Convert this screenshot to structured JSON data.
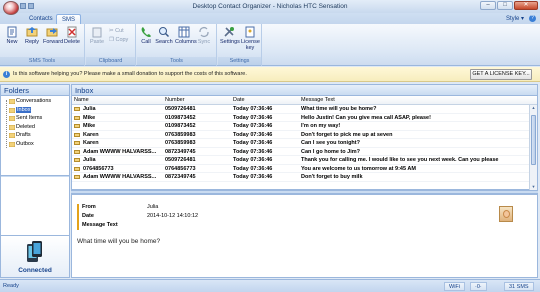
{
  "window": {
    "title": "Desktop Contact Organizer - Nicholas HTC Sensation",
    "minimize": "–",
    "maximize": "□",
    "close": "✕"
  },
  "tabs": [
    {
      "label": "Contacts",
      "active": false
    },
    {
      "label": "SMS",
      "active": true
    }
  ],
  "style_menu": "Style ▾",
  "help": "?",
  "ribbon": {
    "sms_tools": {
      "label": "SMS Tools",
      "buttons": [
        "New",
        "Reply",
        "Forward",
        "Delete"
      ]
    },
    "clipboard": {
      "label": "Clipboard",
      "paste": "Paste",
      "cut": "Cut",
      "copy": "Copy"
    },
    "tools": {
      "label": "Tools",
      "buttons": [
        "Call",
        "Search",
        "Columns",
        "Sync"
      ]
    },
    "settings": {
      "label": "Settings",
      "settings": "Settings",
      "license_key_1": "License",
      "license_key_2": "key"
    }
  },
  "infobar": {
    "icon": "i",
    "text": "Is this software helping you? Please make a small donation to support the costs of this software.",
    "button": "GET A LICENSE KEY..."
  },
  "folders": {
    "title": "Folders",
    "items": [
      "Conversations",
      "Inbox",
      "Sent Items",
      "Deleted",
      "Drafts",
      "Outbox"
    ],
    "selected": "Inbox",
    "connection_status": "Connected"
  },
  "inbox": {
    "title": "Inbox",
    "columns": [
      "Name",
      "Number",
      "Date",
      "Message Text"
    ],
    "rows": [
      {
        "name": "Julia",
        "number": "0509726481",
        "date": "Today  07:36:46",
        "text": "What time will you be home?"
      },
      {
        "name": "Mike",
        "number": "0109873452",
        "date": "Today  07:36:46",
        "text": "Hello Justin! Can you give mea call ASAP, please!"
      },
      {
        "name": "Mike",
        "number": "0109873452",
        "date": "Today  07:36:46",
        "text": "I'm on my way!"
      },
      {
        "name": "Karen",
        "number": "0763859983",
        "date": "Today  07:36:46",
        "text": "Don't forget to pick me up at seven"
      },
      {
        "name": "Karen",
        "number": "0763859983",
        "date": "Today  07:36:46",
        "text": "Can I see you tonight?"
      },
      {
        "name": "Adam WWWW  HALVARSS...",
        "number": "0872349745",
        "date": "Today  07:36:46",
        "text": "Can I go home to Jim?"
      },
      {
        "name": "Julia",
        "number": "0509726481",
        "date": "Today  07:36:46",
        "text": "Thank you for calling me. I would like to see you next week. Can you please"
      },
      {
        "name": "0764856773",
        "number": "0764856773",
        "date": "Today  07:36:46",
        "text": "You are welcome to us tomorrow at 9:45 AM"
      },
      {
        "name": "Adam WWWW  HALVARSS...",
        "number": "0872349745",
        "date": "Today  07:36:46",
        "text": "Don't forget to buy milk"
      }
    ]
  },
  "preview": {
    "from_label": "From",
    "from_value": "Julia",
    "date_label": "Date",
    "date_value": "2014-10-12 14:10:12",
    "text_label": "Message Text",
    "body": "What time will you be home?"
  },
  "statusbar": {
    "left": "Ready",
    "wifi": "WiFi",
    "signal": "·0·",
    "sms_count": "31 SMS"
  }
}
